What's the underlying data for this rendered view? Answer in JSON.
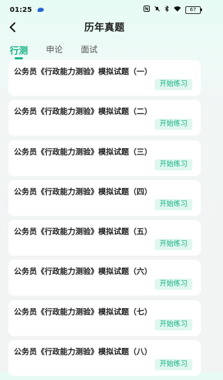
{
  "status_bar": {
    "time": "01:25",
    "battery": "67",
    "icons": [
      "nfc-icon",
      "mute-icon",
      "bluetooth-icon",
      "wifi-icon",
      "battery-icon"
    ]
  },
  "header": {
    "title": "历年真题",
    "back_icon": "chevron-left-icon"
  },
  "tabs": [
    {
      "label": "行测",
      "active": true
    },
    {
      "label": "申论",
      "active": false
    },
    {
      "label": "面试",
      "active": false
    }
  ],
  "items": [
    {
      "title": "公务员《行政能力测验》模拟试题（一）",
      "action": "开始练习"
    },
    {
      "title": "公务员《行政能力测验》模拟试题（二）",
      "action": "开始练习"
    },
    {
      "title": "公务员《行政能力测验》模拟试题（三）",
      "action": "开始练习"
    },
    {
      "title": "公务员《行政能力测验》模拟试题（四）",
      "action": "开始练习"
    },
    {
      "title": "公务员《行政能力测验》模拟试题（五）",
      "action": "开始练习"
    },
    {
      "title": "公务员《行政能力测验》模拟试题（六）",
      "action": "开始练习"
    },
    {
      "title": "公务员《行政能力测验》模拟试题（七）",
      "action": "开始练习"
    },
    {
      "title": "公务员《行政能力测验》模拟试题（八）",
      "action": "开始练习"
    }
  ],
  "colors": {
    "accent": "#17b285",
    "button_bg": "#dff7ef"
  }
}
